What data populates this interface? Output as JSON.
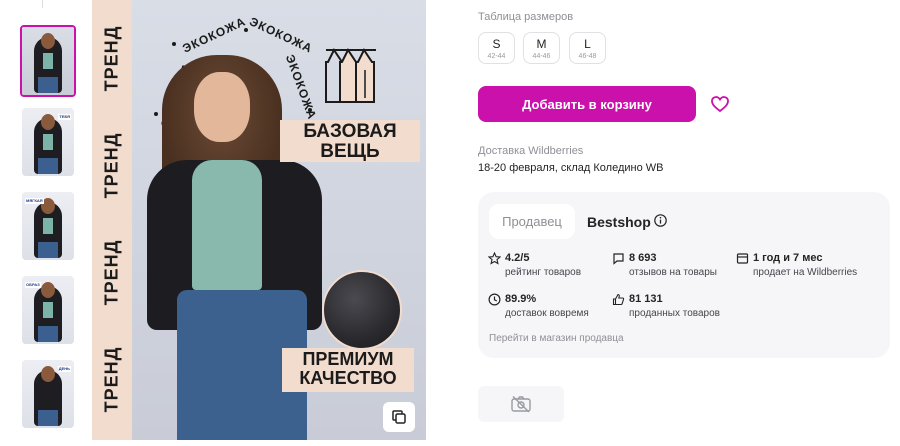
{
  "gallery": {
    "thumbnail_count": 5,
    "active_thumbnail": 0,
    "thumbnails": [
      {
        "tag": ""
      },
      {
        "tag": "ТЕБЯ"
      },
      {
        "tag": "МЯГКАЯ"
      },
      {
        "tag": "ОБРАЗ"
      },
      {
        "tag": "ДЕНЬ"
      }
    ]
  },
  "main_image": {
    "trend_words": [
      "ТРЕНД",
      "ТРЕНД",
      "ТРЕНД",
      "ТРЕНД"
    ],
    "arc_words": [
      "ЭКОКОЖА",
      "ЭКОКОЖА",
      "ЭКОКОЖА",
      "ЭКОКОЖА"
    ],
    "badge_basic": "БАЗОВАЯ ВЕЩЬ",
    "badge_premium": "ПРЕМИУМ КАЧЕСТВО",
    "copy_icon": "copy-icon"
  },
  "sizes": {
    "title": "Таблица размеров",
    "options": [
      {
        "size": "S",
        "range": "42-44"
      },
      {
        "size": "M",
        "range": "44-46"
      },
      {
        "size": "L",
        "range": "46-48"
      }
    ]
  },
  "actions": {
    "add_to_cart": "Добавить в корзину",
    "favorite_icon": "heart-icon",
    "accent_color": "#cb11ab"
  },
  "delivery": {
    "title": "Доставка Wildberries",
    "date_text": "18-20 февраля, склад Коледино WB"
  },
  "seller": {
    "tab_label": "Продавец",
    "name": "Bestshop",
    "stats": [
      {
        "icon": "star-icon",
        "value": "4.2/5",
        "label": "рейтинг товаров"
      },
      {
        "icon": "chat-icon",
        "value": "8 693",
        "label": "отзывов на товары"
      },
      {
        "icon": "shop-icon",
        "value": "1 год и 7 мес",
        "label": "продает на Wildberries"
      },
      {
        "icon": "clock-icon",
        "value": "89.9%",
        "label": "доставок вовремя"
      },
      {
        "icon": "thumbs-up-icon",
        "value": "81 131",
        "label": "проданных товаров"
      }
    ],
    "store_link": "Перейти в магазин продавца"
  },
  "media_placeholder_icon": "camera-off-icon"
}
